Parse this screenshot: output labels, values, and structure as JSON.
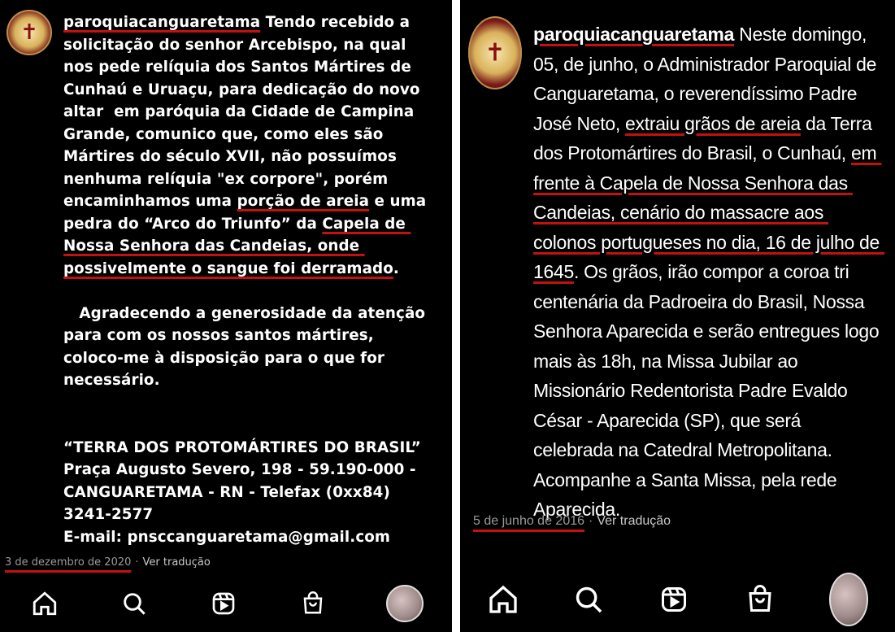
{
  "left_post": {
    "username": "paroquiacanguaretama",
    "caption_intro": " Tendo recebido a solicitação do senhor Arcebispo, na qual nos pede relíquia dos Santos Mártires de Cunhaú e Uruaçu, para dedicação do novo altar  em paróquia da Cidade de Campina Grande, comunico que, como eles são Mártires do século XVII, não possuímos nenhuma relíquia \"ex corpore\", porém encaminhamos uma ",
    "caption_hl1": "porção de areia",
    "caption_mid": " e uma pedra do “Arco do Triunfo” da ",
    "caption_hl2": "Capela de Nossa Senhora das Candeias, onde possivelmente o sangue foi derramado",
    "caption_end": ".",
    "caption_p2": "   Agradecendo a generosidade da atenção para com os nossos santos mártires, coloco-me à disposição para o que for necessário.",
    "caption_p3": "“TERRA DOS PROTOMÁRTIRES DO BRASIL”\nPraça Augusto Severo, 198 - 59.190-000 - CANGUARETAMA - RN - Telefax (0xx84) 3241-2577\nE-mail: pnsccanguaretama@gmail.com",
    "date": "3 de dezembro de 2020",
    "separator": "·",
    "translate": "Ver tradução"
  },
  "right_post": {
    "username": "paroquiacanguaretama",
    "caption_a": " Neste domingo, 05, de junho, o Administrador Paroquial de Canguaretama, o reverendíssimo Padre José Neto, ",
    "caption_hl1": "extraiu grãos de areia",
    "caption_b": " da Terra dos Protomártires do Brasil, o Cunhaú, ",
    "caption_hl2": "em frente à Capela de Nossa Senhora das Candeias, cenário do massacre aos colonos portugueses no dia, 16 de julho de 1645",
    "caption_c": ". Os grãos, irão compor a coroa tri centenária da Padroeira do Brasil, Nossa Senhora Aparecida e serão entregues logo mais às 18h, na Missa Jubilar ao Missionário Redentorista Padre Evaldo César - Aparecida (SP), que será celebrada na Catedral Metropolitana. Acompanhe a Santa Missa, pela rede Aparecida.",
    "date": "5 de junho de 2016",
    "separator": "·",
    "translate": "Ver tradução"
  },
  "nav": {
    "icons": [
      "home-icon",
      "search-icon",
      "reels-icon",
      "shop-icon",
      "profile-avatar"
    ]
  },
  "colors": {
    "background": "#000000",
    "text": "#ffffff",
    "underline": "#c31010",
    "meta": "#9a9a9a"
  }
}
